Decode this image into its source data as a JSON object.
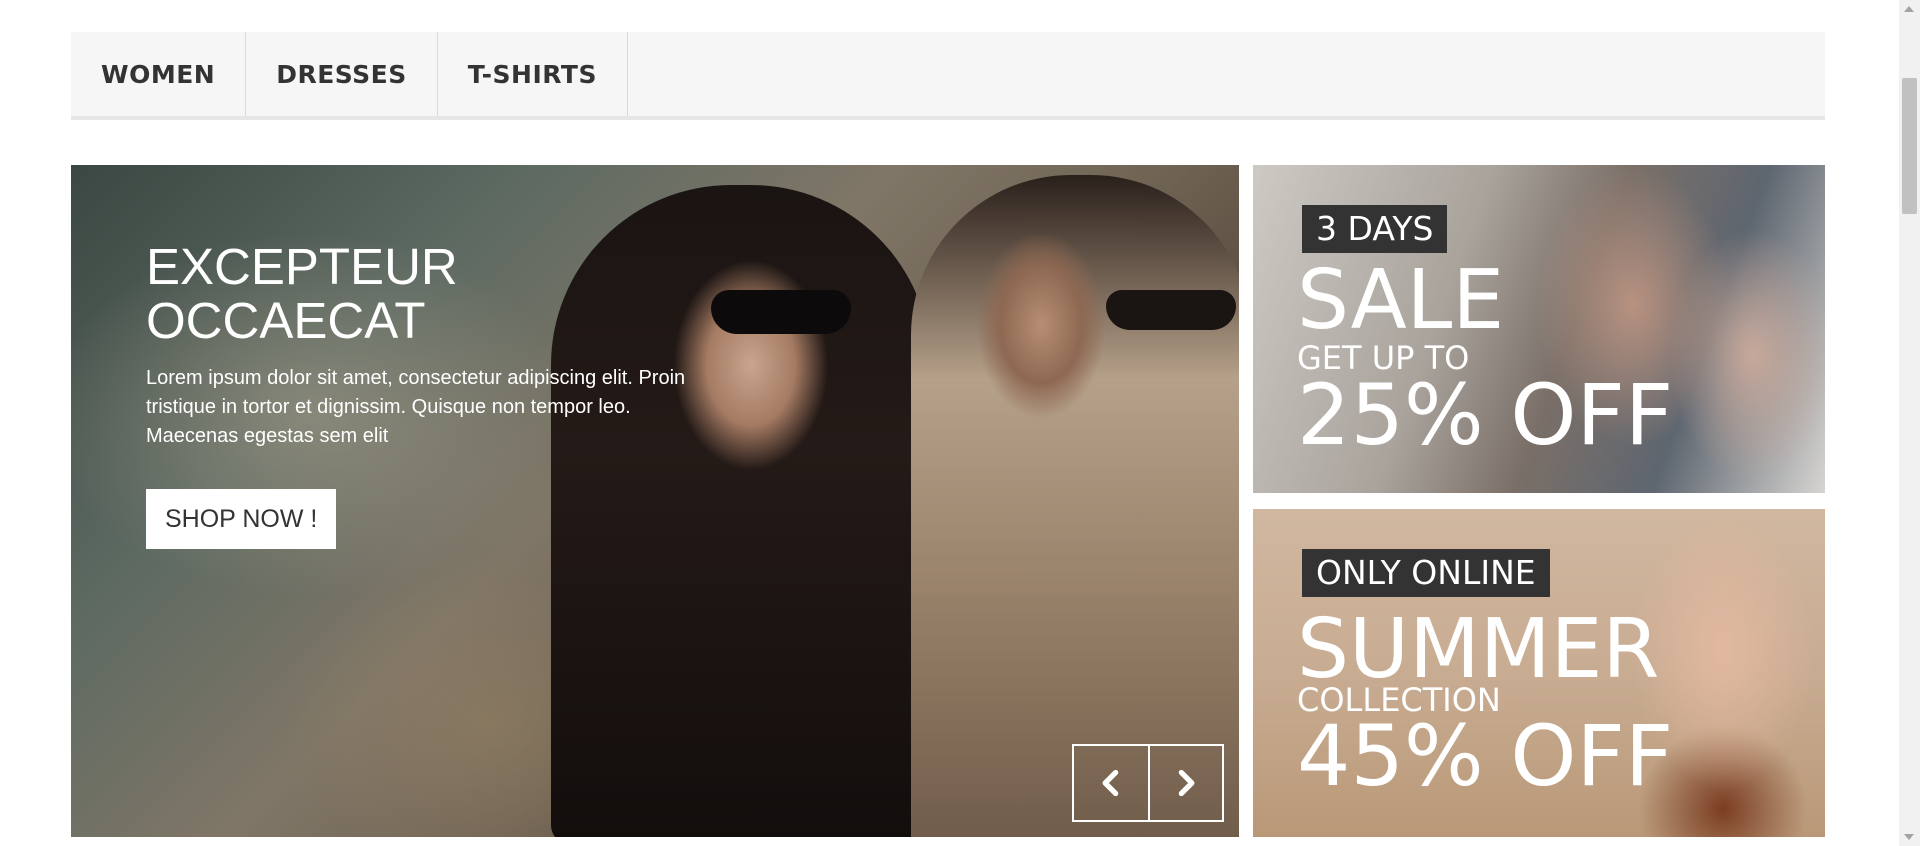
{
  "nav": {
    "items": [
      {
        "label": "WOMEN"
      },
      {
        "label": "DRESSES"
      },
      {
        "label": "T-SHIRTS"
      }
    ]
  },
  "hero": {
    "title": "EXCEPTEUR OCCAECAT",
    "text": "Lorem ipsum dolor sit amet, consectetur adipiscing elit. Proin tristique in tortor et dignissim. Quisque non tempor leo. Maecenas egestas sem elit",
    "button_label": "SHOP NOW !",
    "prev_icon": "chevron-left-icon",
    "next_icon": "chevron-right-icon"
  },
  "banners": [
    {
      "tag": "3 DAYS",
      "line1": "SALE",
      "line2": "GET UP TO",
      "line3": "25% OFF"
    },
    {
      "tag": "ONLY ONLINE",
      "line1": "SUMMER",
      "line2": "COLLECTION",
      "line3": "45% OFF"
    }
  ],
  "colors": {
    "nav_bg": "#f6f6f6",
    "tag_bg": "#333333",
    "text_light": "#ffffff",
    "text_dark": "#333333"
  }
}
